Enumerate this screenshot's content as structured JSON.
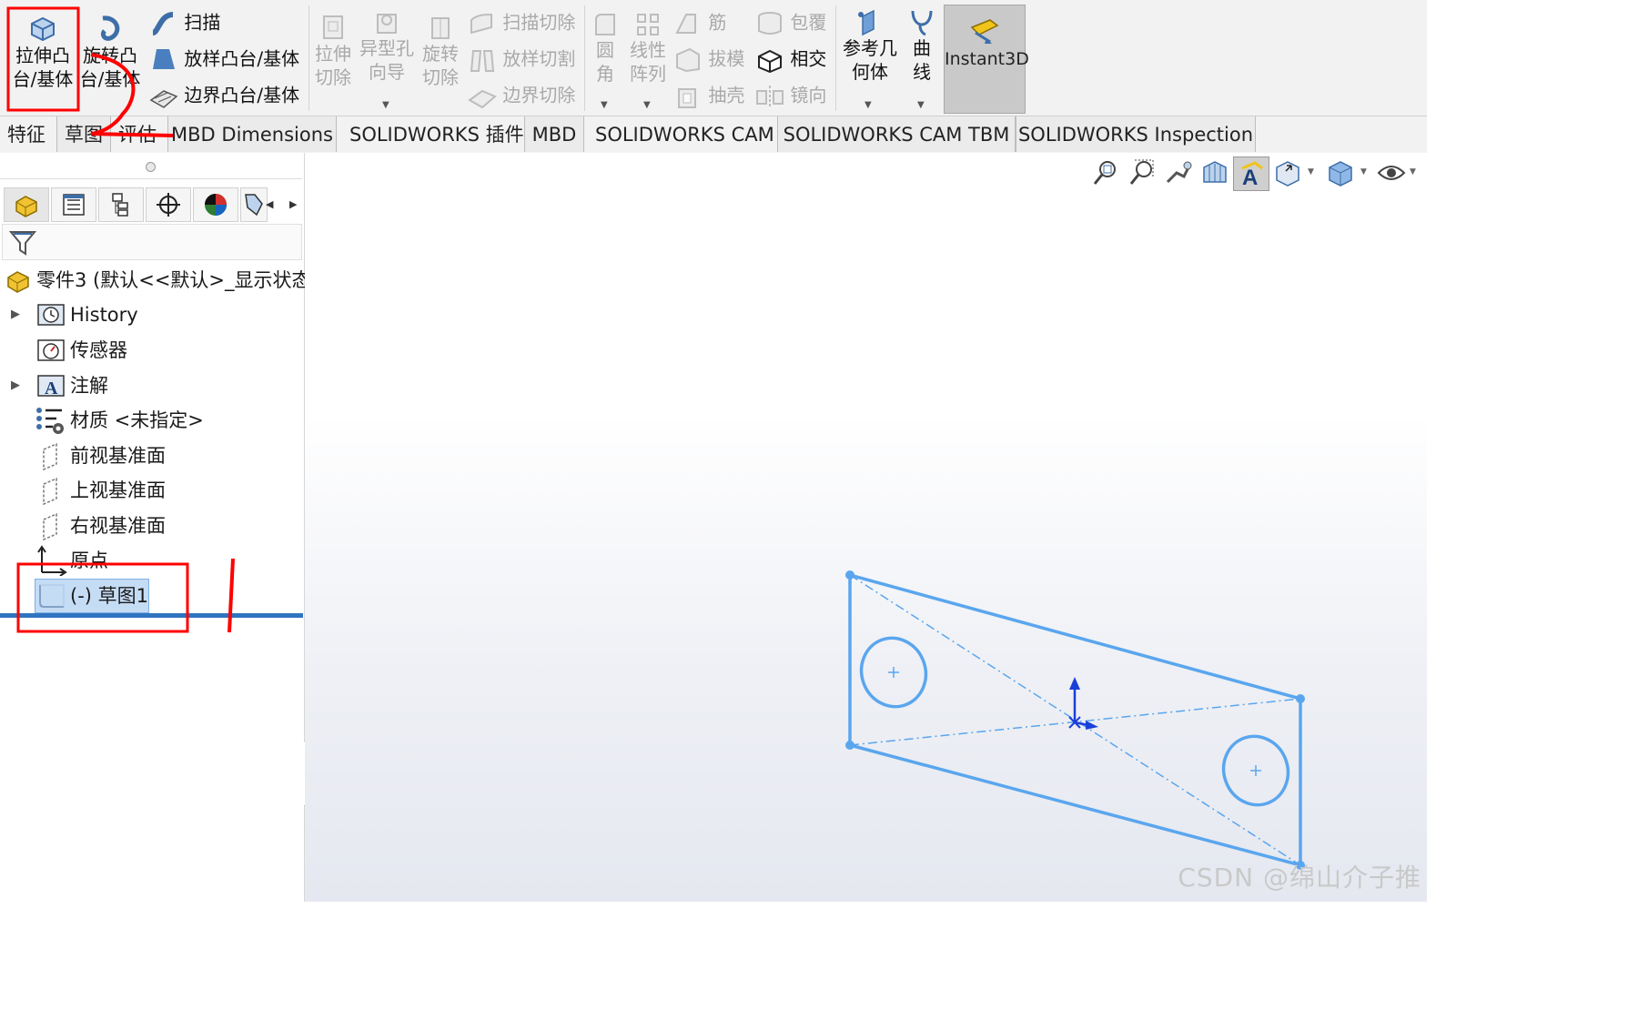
{
  "ribbon": {
    "extrude_boss": [
      "拉伸凸",
      "台/基体"
    ],
    "revolve_boss": [
      "旋转凸",
      "台/基体"
    ],
    "sweep": "扫描",
    "loft_boss": "放样凸台/基体",
    "boundary_boss": "边界凸台/基体",
    "extrude_cut": [
      "拉伸",
      "切除"
    ],
    "hole_wizard": [
      "异型孔",
      "向导"
    ],
    "revolve_cut": [
      "旋转",
      "切除"
    ],
    "swept_cut": "扫描切除",
    "lofted_cut": "放样切割",
    "boundary_cut": "边界切除",
    "fillet": [
      "圆",
      "角"
    ],
    "linear_pattern": [
      "线性",
      "阵列"
    ],
    "rib": "筋",
    "draft": "拔模",
    "shell": "抽壳",
    "wrap": "包覆",
    "intersect": "相交",
    "mirror": "镜向",
    "ref_geometry": [
      "参考几",
      "何体"
    ],
    "curves": [
      "曲",
      "线"
    ],
    "instant3d": "Instant3D"
  },
  "tabs": [
    "特征",
    "草图",
    "评估",
    "MBD Dimensions",
    "SOLIDWORKS 插件",
    "MBD",
    "SOLIDWORKS CAM",
    "SOLIDWORKS CAM TBM",
    "SOLIDWORKS Inspection"
  ],
  "tree": {
    "root": "零件3  (默认<<默认>_显示状态",
    "items": [
      "History",
      "传感器",
      "注解",
      "材质 <未指定>",
      "前视基准面",
      "上视基准面",
      "右视基准面",
      "原点",
      "(-) 草图1"
    ]
  },
  "watermark": "CSDN @绵山介子推",
  "colors": {
    "sketch": "#5aa6ee",
    "annotation": "#ff0000",
    "selected": "#c5dcf5",
    "accent": "#2f74c0"
  }
}
